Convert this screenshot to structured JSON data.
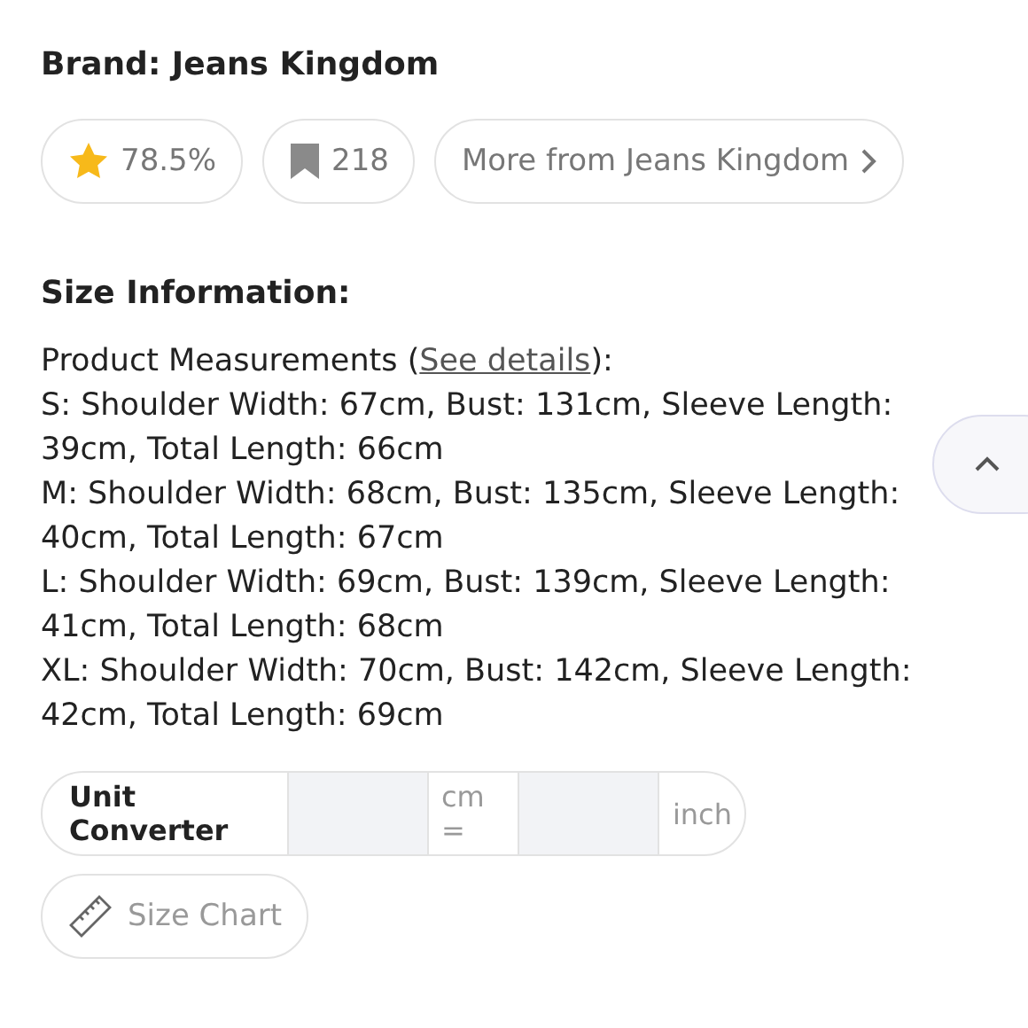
{
  "brand": "Brand: Jeans Kingdom",
  "chips": [
    {
      "kind": "rating",
      "label": "78.5%"
    },
    {
      "kind": "saves",
      "label": "218"
    },
    {
      "kind": "link",
      "label": "More from Jeans Kingdom"
    }
  ],
  "size_heading": "Size Information:",
  "measurements_intro": {
    "before": "Product Measurements (",
    "link": "See details",
    "after": "):"
  },
  "measurements": [
    "S: Shoulder Width: 67cm, Bust: 131cm, Sleeve Length: 39cm, Total Length: 66cm",
    "M: Shoulder Width: 68cm, Bust: 135cm, Sleeve Length: 40cm, Total Length: 67cm",
    "L: Shoulder Width: 69cm, Bust: 139cm, Sleeve Length: 41cm, Total Length: 68cm",
    "XL: Shoulder Width: 70cm, Bust: 142cm, Sleeve Length: 42cm, Total Length: 69cm"
  ],
  "converter": {
    "label": "Unit Converter",
    "unit_from": "cm =",
    "unit_to": "inch"
  },
  "size_chart": "Size Chart"
}
